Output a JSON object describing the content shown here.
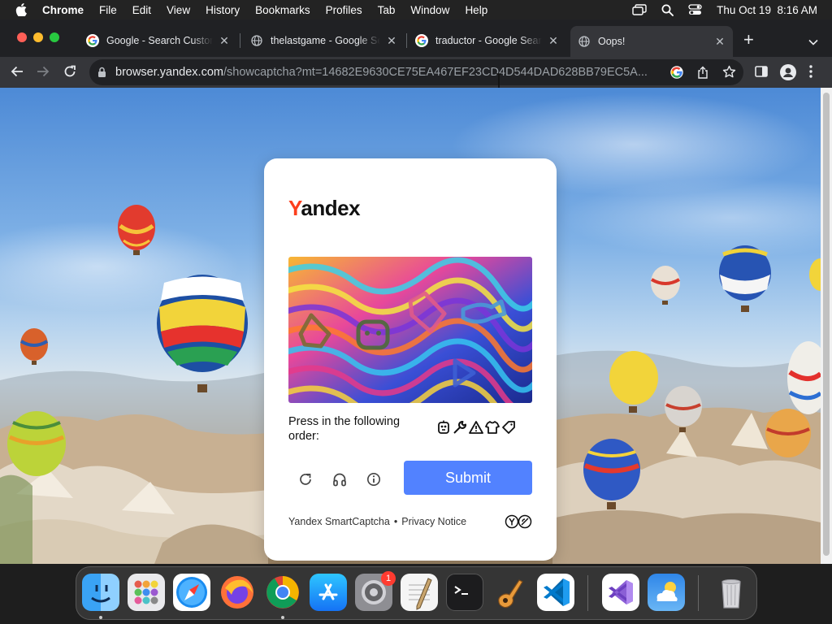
{
  "menubar": {
    "app_name": "Chrome",
    "items": [
      "File",
      "Edit",
      "View",
      "History",
      "Bookmarks",
      "Profiles",
      "Tab",
      "Window",
      "Help"
    ],
    "datetime": "Thu Oct 19  8:16 AM"
  },
  "tabs": [
    {
      "title": "Google - Search Custom",
      "icon": "google-icon",
      "active": false
    },
    {
      "title": "thelastgame - Google Search",
      "icon": "globe-icon",
      "active": false
    },
    {
      "title": "traductor - Google Search",
      "icon": "google-icon",
      "active": false
    },
    {
      "title": "Oops!",
      "icon": "globe-icon",
      "active": true
    }
  ],
  "toolbar": {
    "url_host": "browser.yandex.com",
    "url_path": "/showcaptcha?mt=14682E9630CE75EA467EF23CD4D544DAD628BB79EC5A..."
  },
  "captcha": {
    "logo_first": "Y",
    "logo_rest": "andex",
    "instruction": "Press in the following order:",
    "order_icons": [
      "robot-icon",
      "wrench-icon",
      "warning-icon",
      "shirt-icon",
      "tag-icon"
    ],
    "submit_label": "Submit",
    "footer_brand": "Yandex SmartCaptcha",
    "footer_separator": "•",
    "footer_privacy": "Privacy Notice"
  },
  "dock": {
    "apps": [
      "finder-icon",
      "launchpad-icon",
      "safari-icon",
      "firefox-icon",
      "chrome-icon",
      "app-store-icon",
      "system-settings-icon",
      "textedit-icon",
      "terminal-icon",
      "garageband-icon",
      "vscode-icon",
      "visual-studio-icon",
      "weather-icon",
      "trash-icon"
    ],
    "settings_badge": "1"
  },
  "colors": {
    "yandex_red": "#fc3f1d",
    "submit_blue": "#5282ff",
    "chrome_dark": "#202124",
    "chrome_toolbar": "#35363a"
  }
}
